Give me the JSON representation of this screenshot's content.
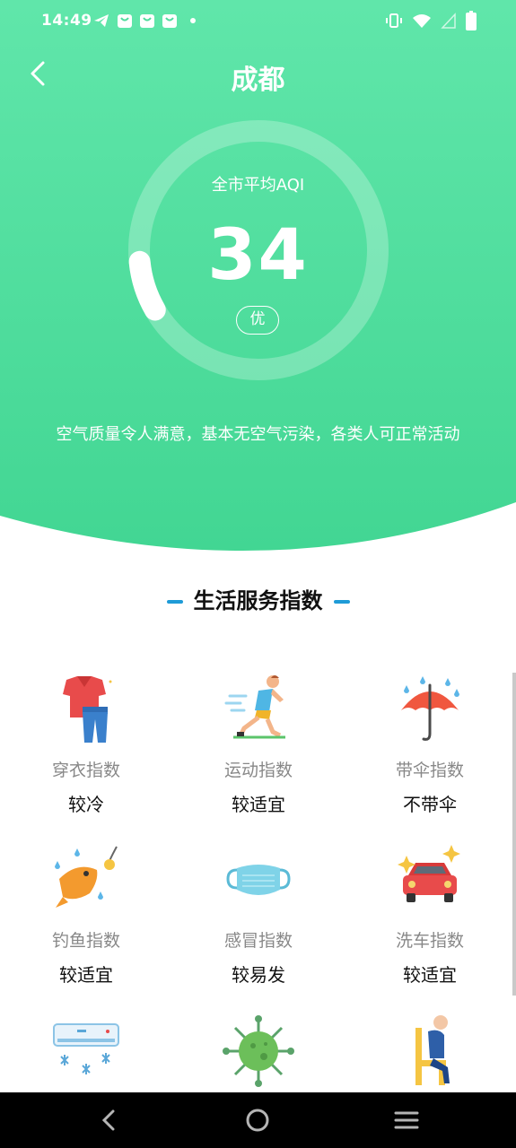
{
  "status_bar": {
    "time": "14:49"
  },
  "header": {
    "title": "成都"
  },
  "aqi": {
    "label": "全市平均AQI",
    "value": "34",
    "value_numeric": 34,
    "level": "优",
    "description": "空气质量令人满意，基本无空气污染，各类人可正常活动"
  },
  "section": {
    "title": "生活服务指数"
  },
  "indices": [
    {
      "name": "穿衣指数",
      "value": "较冷",
      "icon": "clothing-icon"
    },
    {
      "name": "运动指数",
      "value": "较适宜",
      "icon": "running-icon"
    },
    {
      "name": "带伞指数",
      "value": "不带伞",
      "icon": "umbrella-icon"
    },
    {
      "name": "钓鱼指数",
      "value": "较适宜",
      "icon": "fishing-icon"
    },
    {
      "name": "感冒指数",
      "value": "较易发",
      "icon": "mask-icon"
    },
    {
      "name": "洗车指数",
      "value": "较适宜",
      "icon": "car-wash-icon"
    },
    {
      "name": "",
      "value": "",
      "icon": "air-conditioner-icon"
    },
    {
      "name": "",
      "value": "",
      "icon": "virus-icon"
    },
    {
      "name": "",
      "value": "",
      "icon": "sitting-person-icon"
    }
  ],
  "colors": {
    "hero_top": "#5ee4a8",
    "hero_bottom": "#43d795",
    "accent_bar": "#1e9bd7"
  }
}
